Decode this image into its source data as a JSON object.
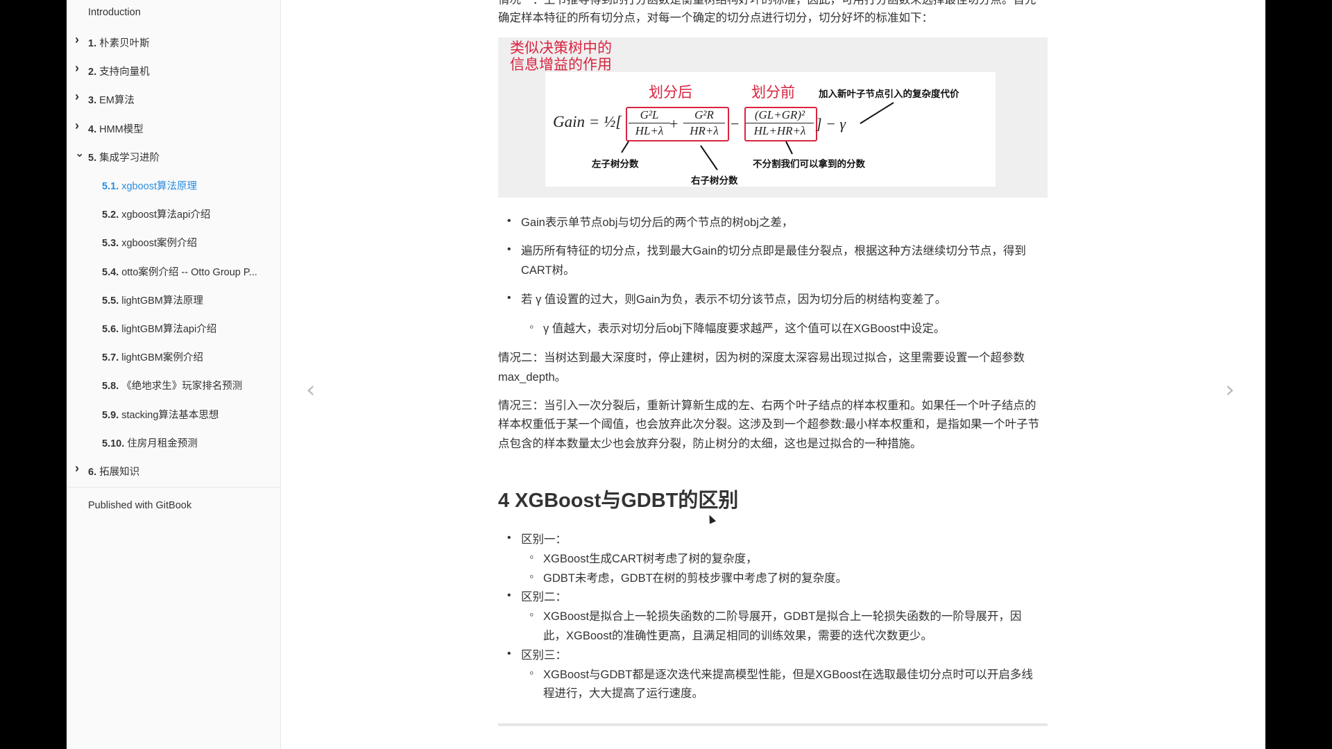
{
  "sidebar": {
    "intro": "Introduction",
    "items": [
      {
        "num": "1.",
        "label": "朴素贝叶斯",
        "expanded": false
      },
      {
        "num": "2.",
        "label": "支持向量机",
        "expanded": false
      },
      {
        "num": "3.",
        "label": "EM算法",
        "expanded": false
      },
      {
        "num": "4.",
        "label": "HMM模型",
        "expanded": false
      },
      {
        "num": "5.",
        "label": "集成学习进阶",
        "expanded": true
      },
      {
        "num": "6.",
        "label": "拓展知识",
        "expanded": false
      }
    ],
    "subitems": [
      {
        "num": "5.1.",
        "label": "xgboost算法原理",
        "active": true
      },
      {
        "num": "5.2.",
        "label": "xgboost算法api介绍"
      },
      {
        "num": "5.3.",
        "label": "xgboost案例介绍"
      },
      {
        "num": "5.4.",
        "label": "otto案例介绍 -- Otto Group P..."
      },
      {
        "num": "5.5.",
        "label": "lightGBM算法原理"
      },
      {
        "num": "5.6.",
        "label": "lightGBM算法api介绍"
      },
      {
        "num": "5.7.",
        "label": "lightGBM案例介绍"
      },
      {
        "num": "5.8.",
        "label": "《绝地求生》玩家排名预测"
      },
      {
        "num": "5.9.",
        "label": "stacking算法基本思想"
      },
      {
        "num": "5.10.",
        "label": "住房月租金预测"
      }
    ],
    "footer": "Published with GitBook",
    "active_color": "#2b8ce0"
  },
  "content": {
    "intro_line1": "情况一：上节推导得到的打分函数是衡量树结构好坏的标准，因此，可用打分函数来选择最佳切分点。首先",
    "intro_line2": "确定样本特征的所有切分点，对每一个确定的切分点进行切分，切分好坏的标准如下：",
    "figure": {
      "note_line1": "类似决策树中的",
      "note_line2": "信息增益的作用",
      "after_split": "划分后",
      "before_split": "划分前",
      "cost_label": "加入新叶子节点引入的复杂度代价",
      "left_score": "左子树分数",
      "right_score": "右子树分数",
      "no_split_score": "不分割我们可以拿到的分数",
      "gain": "Gain = ½[",
      "gl_num": "G²L",
      "gl_den": "HL+λ",
      "gr_num": "G²R",
      "gr_den": "HR+λ",
      "all_num": "(GL+GR)²",
      "all_den": "HL+HR+λ",
      "gamma": "] − γ",
      "accent_color": "#d8243f"
    },
    "bullets": [
      "Gain表示单节点obj与切分后的两个节点的树obj之差，",
      "遍历所有特征的切分点，找到最大Gain的切分点即是最佳分裂点，根据这种方法继续切分节点，得到",
      "CART树。",
      "若 γ 值设置的过大，则Gain为负，表示不切分该节点，因为切分后的树结构变差了。"
    ],
    "sub_bullet": "γ 值越大，表示对切分后obj下降幅度要求越严，这个值可以在XGBoost中设定。",
    "case2": [
      "情况二：当树达到最大深度时，停止建树，因为树的深度太深容易出现过拟合，这里需要设置一个超参数",
      "max_depth。"
    ],
    "case3": [
      "情况三：当引入一次分裂后，重新计算新生成的左、右两个叶子结点的样本权重和。如果任一个叶子结点的",
      "样本权重低于某一个阈值，也会放弃此次分裂。这涉及到一个超参数:最小样本权重和，是指如果一个叶子节",
      "点包含的样本数量太少也会放弃分裂，防止树分的太细，这也是过拟合的一种措施。"
    ],
    "heading": "4 XGBoost与GDBT的区别",
    "diffs": [
      {
        "label": "区别一：",
        "subs": [
          [
            "XGBoost生成CART树考虑了树的复杂度，"
          ],
          [
            "GDBT未考虑，GDBT在树的剪枝步骤中考虑了树的复杂度。"
          ]
        ]
      },
      {
        "label": "区别二：",
        "subs": [
          [
            "XGBoost是拟合上一轮损失函数的二阶导展开，GDBT是拟合上一轮损失函数的一阶导展开，因",
            "此，XGBoost的准确性更高，且满足相同的训练效果，需要的迭代次数更少。"
          ]
        ]
      },
      {
        "label": "区别三：",
        "subs": [
          [
            "XGBoost与GDBT都是逐次迭代来提高模型性能，但是XGBoost在选取最佳切分点时可以开启多线",
            "程进行，大大提高了运行速度。"
          ]
        ]
      }
    ]
  },
  "nav": {
    "prev_icon": "chevron-left-icon",
    "next_icon": "chevron-right-icon"
  }
}
